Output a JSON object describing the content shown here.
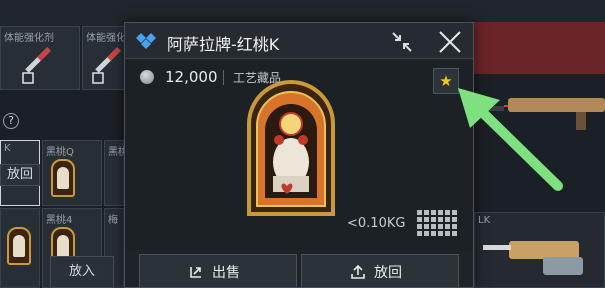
{
  "background": {
    "top_slots": [
      {
        "label": "体能强化剂"
      },
      {
        "label": "体能强化剂"
      }
    ],
    "grid_slots": [
      {
        "label": "K"
      },
      {
        "label": "黑桃Q"
      },
      {
        "label": "黑桃"
      },
      {
        "label": "黑桃4"
      },
      {
        "label": "梅"
      },
      {
        "label": "LK"
      }
    ],
    "side_button_label": "放回",
    "bottom_button_label": "放入",
    "help_glyph": "?"
  },
  "popup": {
    "rarity_icon": "diamond-cluster-icon",
    "title": "阿萨拉牌-红桃K",
    "price": "12,000",
    "category": "工艺藏品",
    "favorite_glyph": "★",
    "weight": "<0.10KG",
    "actions": {
      "sell_label": "出售",
      "return_label": "放回"
    }
  },
  "colors": {
    "accent_blue": "#4aa3f0",
    "favorite_gold": "#f3c623",
    "annotation_green": "#7fe07f",
    "card_gold": "#c99a3a",
    "card_red": "#c0392b"
  }
}
